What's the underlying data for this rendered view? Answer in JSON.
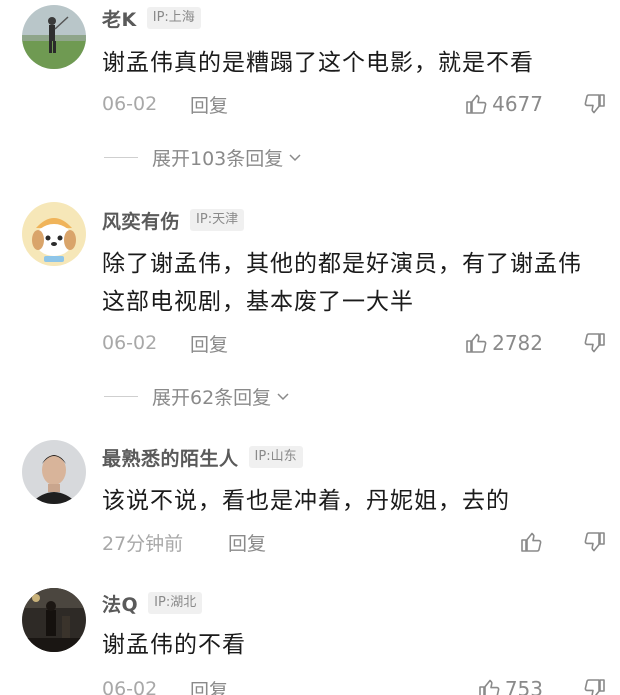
{
  "comments": [
    {
      "username": "老K",
      "ip": "IP:上海",
      "text": "谢孟伟真的是糟蹋了这个电影，就是不看",
      "time": "06-02",
      "reply_label": "回复",
      "likes": "4677",
      "expand_label": "展开103条回复",
      "avatar_icon": "golfer-photo-avatar"
    },
    {
      "username": "风奕有伤",
      "ip": "IP:天津",
      "text": "除了谢孟伟，其他的都是好演员，有了谢孟伟这部电视剧，基本废了一大半",
      "time": "06-02",
      "reply_label": "回复",
      "likes": "2782",
      "expand_label": "展开62条回复",
      "avatar_icon": "cartoon-dog-avatar"
    },
    {
      "username": "最熟悉的陌生人",
      "ip": "IP:山东",
      "text": "该说不说，看也是冲着，丹妮姐，去的",
      "time": "27分钟前",
      "reply_label": "回复",
      "likes": "",
      "avatar_icon": "man-selfie-avatar"
    },
    {
      "username": "法Q",
      "ip": "IP:湖北",
      "text": "谢孟伟的不看",
      "time": "06-02",
      "reply_label": "回复",
      "likes": "753",
      "avatar_icon": "dark-street-photo-avatar"
    }
  ],
  "icons": {
    "like": "thumbs-up-icon",
    "dislike": "thumbs-down-icon",
    "expand": "chevron-down-icon"
  }
}
